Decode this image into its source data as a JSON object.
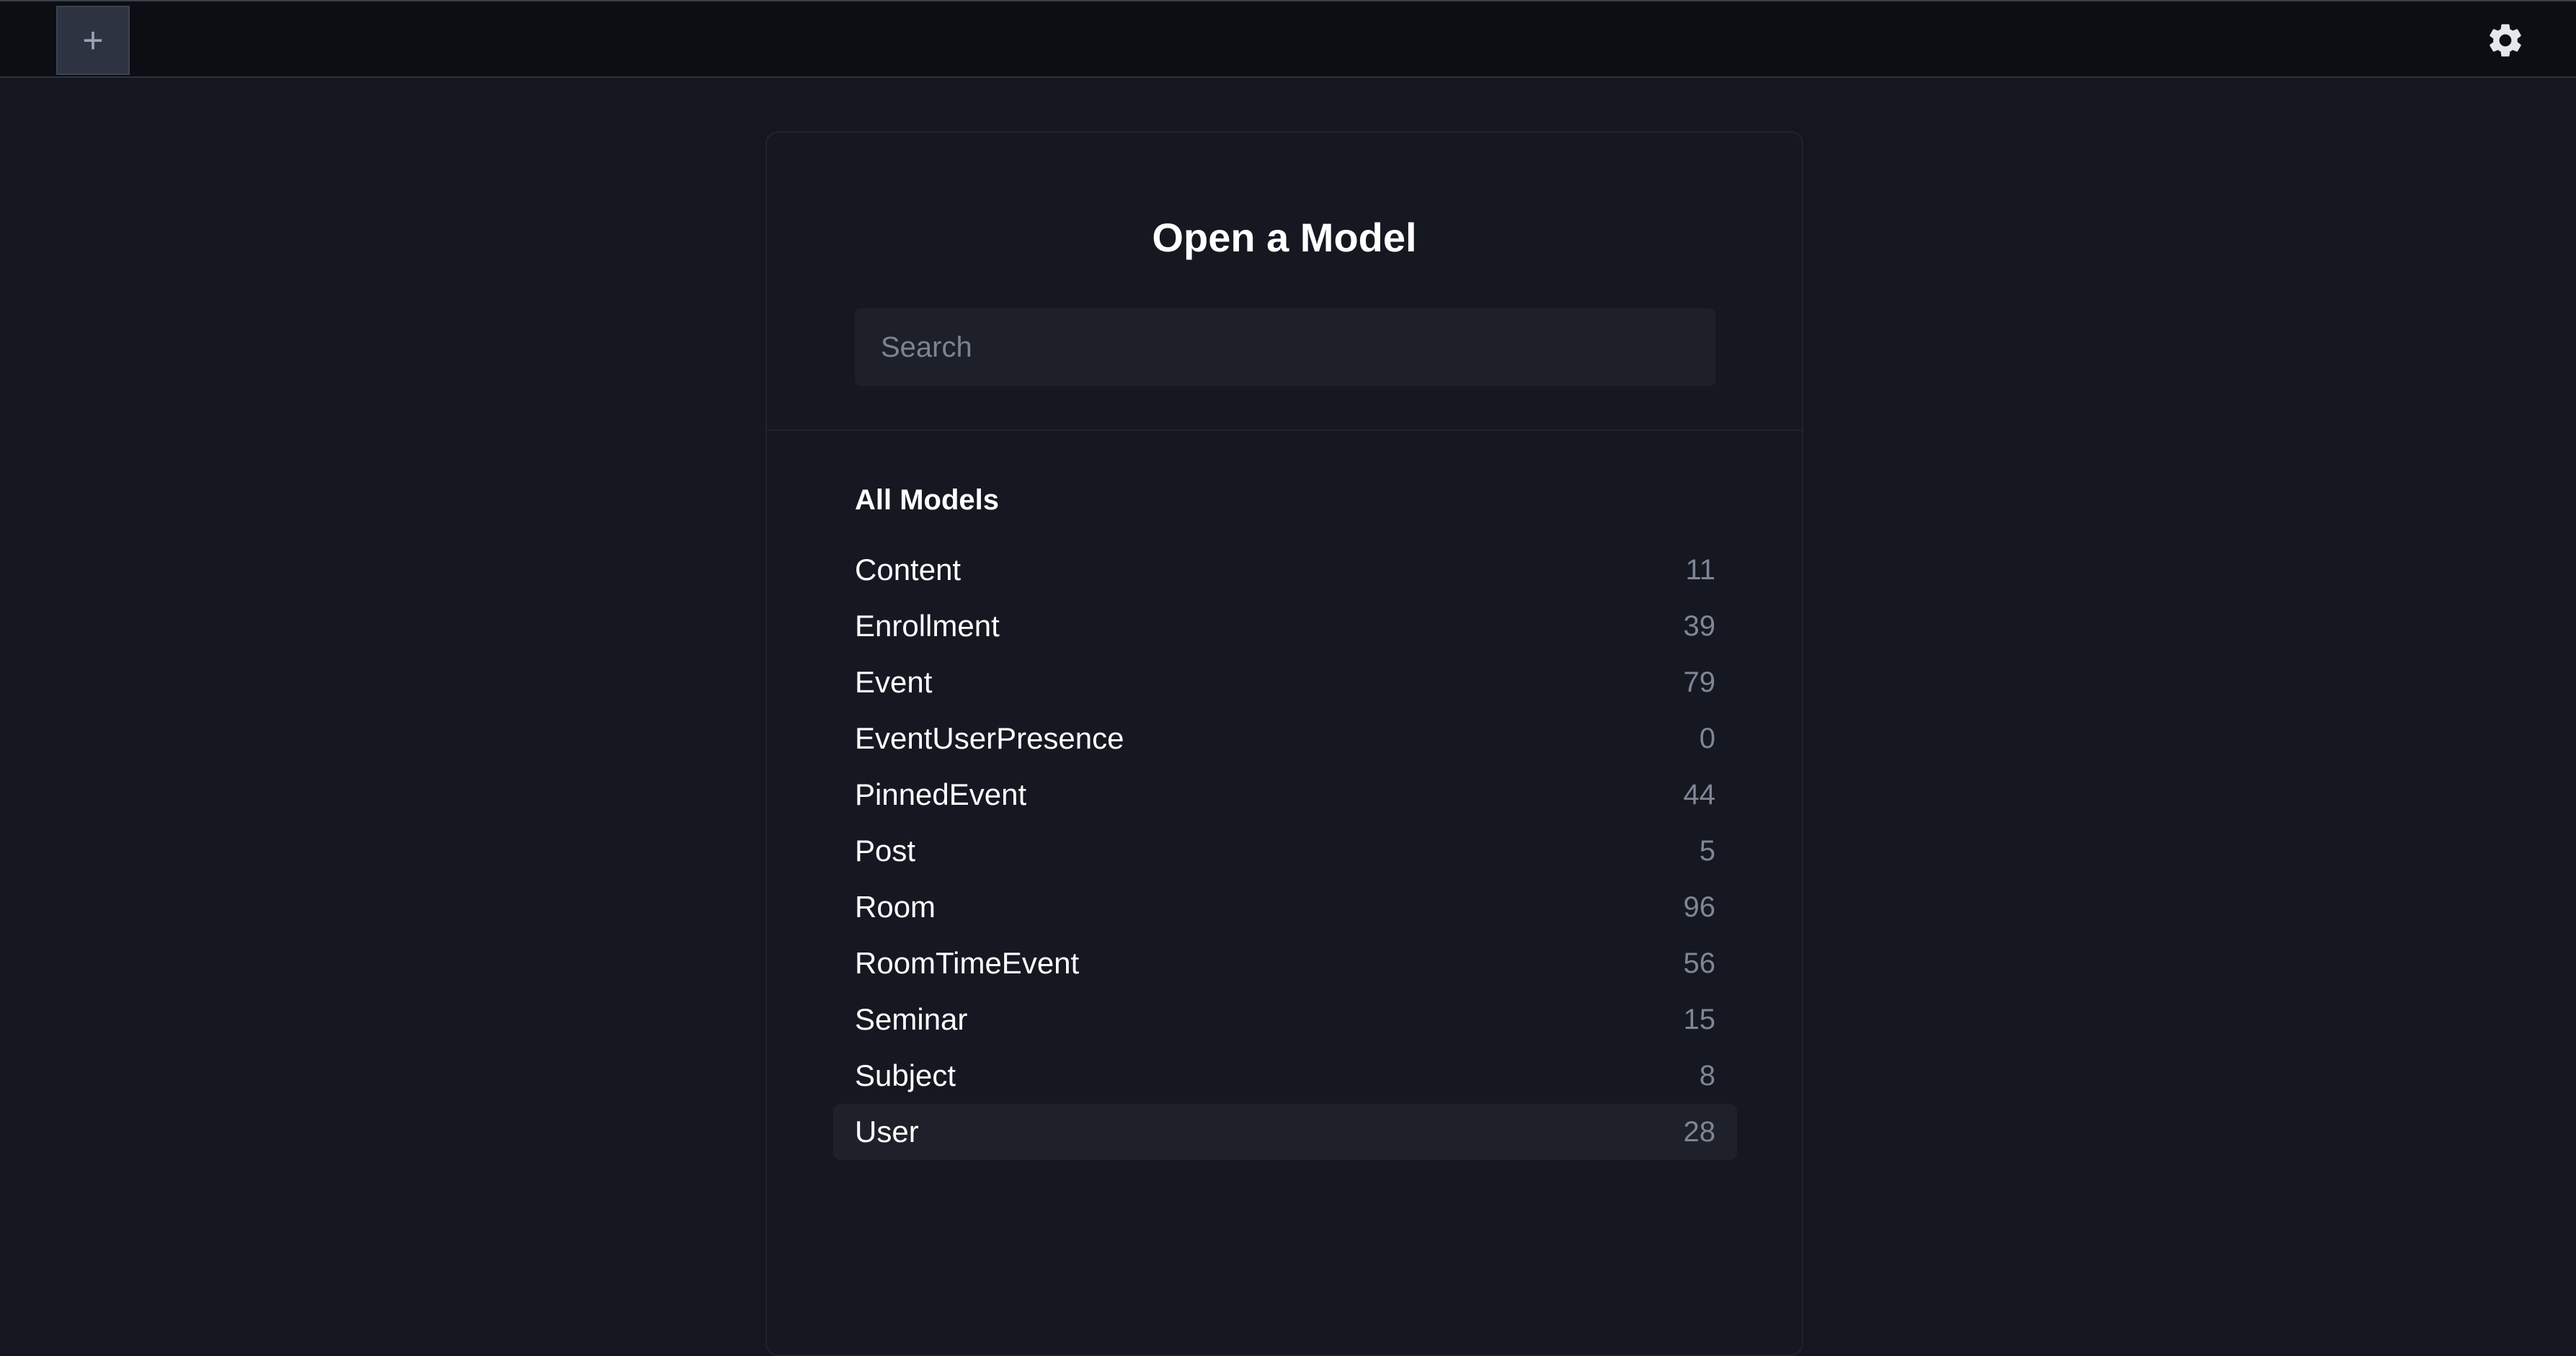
{
  "topbar": {
    "new_tab_label": "+",
    "settings_icon": "gear-icon"
  },
  "panel": {
    "title": "Open a Model",
    "search": {
      "placeholder": "Search",
      "value": ""
    },
    "section_title": "All Models",
    "models": [
      {
        "name": "Content",
        "count": "11"
      },
      {
        "name": "Enrollment",
        "count": "39"
      },
      {
        "name": "Event",
        "count": "79"
      },
      {
        "name": "EventUserPresence",
        "count": "0"
      },
      {
        "name": "PinnedEvent",
        "count": "44"
      },
      {
        "name": "Post",
        "count": "5"
      },
      {
        "name": "Room",
        "count": "96"
      },
      {
        "name": "RoomTimeEvent",
        "count": "56"
      },
      {
        "name": "Seminar",
        "count": "15"
      },
      {
        "name": "Subject",
        "count": "8"
      },
      {
        "name": "User",
        "count": "28",
        "highlighted": true
      }
    ]
  },
  "colors": {
    "background": "#141720",
    "topbar": "#0c0e13",
    "panel": "#151821",
    "search_bg": "#1d2029",
    "row_highlight": "#1e2129",
    "text_primary": "#ffffff",
    "text_muted": "#7f8696"
  }
}
